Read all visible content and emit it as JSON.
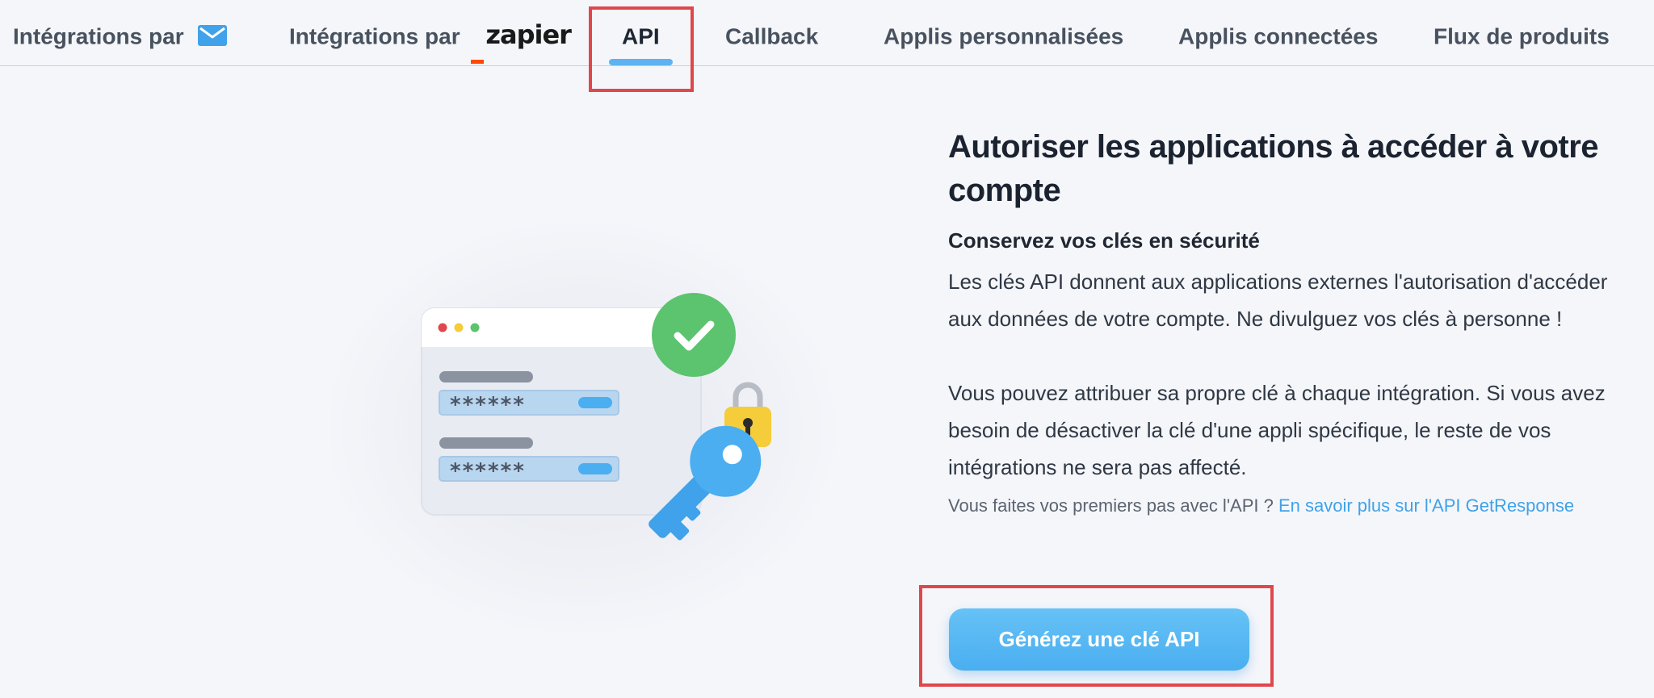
{
  "tabs": [
    {
      "label": "Intégrations par",
      "icon": "envelope-icon"
    },
    {
      "label": "Intégrations par",
      "logo": "zapier"
    },
    {
      "label": "API",
      "active": true
    },
    {
      "label": "Callback"
    },
    {
      "label": "Applis personnalisées"
    },
    {
      "label": "Applis connectées"
    },
    {
      "label": "Flux de produits"
    }
  ],
  "illustration": {
    "password_mask_1": "******",
    "password_mask_2": "******",
    "icons": [
      "browser-window-icon",
      "checkmark-icon",
      "padlock-icon",
      "key-icon"
    ]
  },
  "main": {
    "title": "Autoriser les applications à accéder à votre compte",
    "subtitle": "Conservez vos clés en sécurité",
    "paragraph1": "Les clés API donnent aux applications externes l'autorisation d'accéder aux données de votre compte. Ne divulguez vos clés à personne !",
    "paragraph2": "Vous pouvez attribuer sa propre clé à chaque intégration. Si vous avez besoin de désactiver la clé d'une appli spécifique, le reste de vos intégrations ne sera pas affecté.",
    "help_text": "Vous faites vos premiers pas avec l'API ?",
    "help_link": "En savoir plus sur l'API GetResponse",
    "button_label": "Générez une clé API"
  },
  "colors": {
    "accent": "#4aaef0",
    "highlight": "#e0474c",
    "success": "#5cc36f",
    "lock": "#f5cc3a"
  }
}
